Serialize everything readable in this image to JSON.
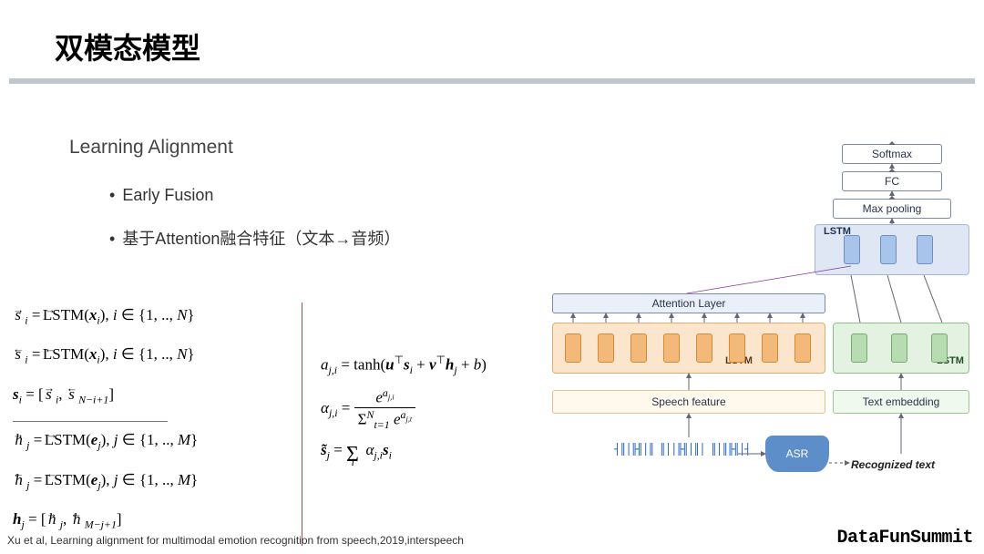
{
  "title": "双模态模型",
  "subtitle": "Learning Alignment",
  "bullets": {
    "b1": "Early Fusion",
    "b2": "基于Attention融合特征（文本→音频）"
  },
  "formulas_s": {
    "line1": "s⃗ᵢ = LSTM⃗(xᵢ), i ∈ {1, .., N}",
    "line2": "s⃖ᵢ = LSTM⃖(xᵢ), i ∈ {1, .., N}",
    "line3": "sᵢ = [s⃗ᵢ, s⃖_{N−i+1}]"
  },
  "formulas_h": {
    "line1": "h⃗ⱼ = LSTM⃗(eⱼ), j ∈ {1, .., M}",
    "line2": "h⃖ⱼ = LSTM⃖(eⱼ), j ∈ {1, .., M}",
    "line3": "hⱼ = [h⃗ⱼ, h⃖_{M−j+1}]"
  },
  "formulas_attn": {
    "a": "a_{j,i} = tanh(uᵀ sᵢ + vᵀ hⱼ + b)",
    "alpha_num": "e^{a_{j,i}}",
    "alpha_den": "Σ_{t=1}^{N} e^{a_{j,t}}",
    "alpha_lhs": "α_{j,i} =",
    "stilde": "s̃ⱼ = Σᵢ α_{j,i} sᵢ"
  },
  "diagram": {
    "softmax": "Softmax",
    "fc": "FC",
    "maxpool": "Max pooling",
    "lstm": "LSTM",
    "attn": "Attention Layer",
    "speech_feature": "Speech feature",
    "text_embed": "Text embedding",
    "asr": "ASR",
    "recognized": "Recognized text",
    "wave": "┤║│╟╢│║ ║││╟╢│║│ ║│║╟╢│┤",
    "colors": {
      "top": "#dfe7f4",
      "speech": "#fbe6cd",
      "text": "#e4f2e1",
      "asr": "#5d8ec9"
    }
  },
  "citation": "Xu et al, Learning alignment for multimodal emotion recognition from speech,2019,interspeech",
  "brand": "DataFunSummit"
}
